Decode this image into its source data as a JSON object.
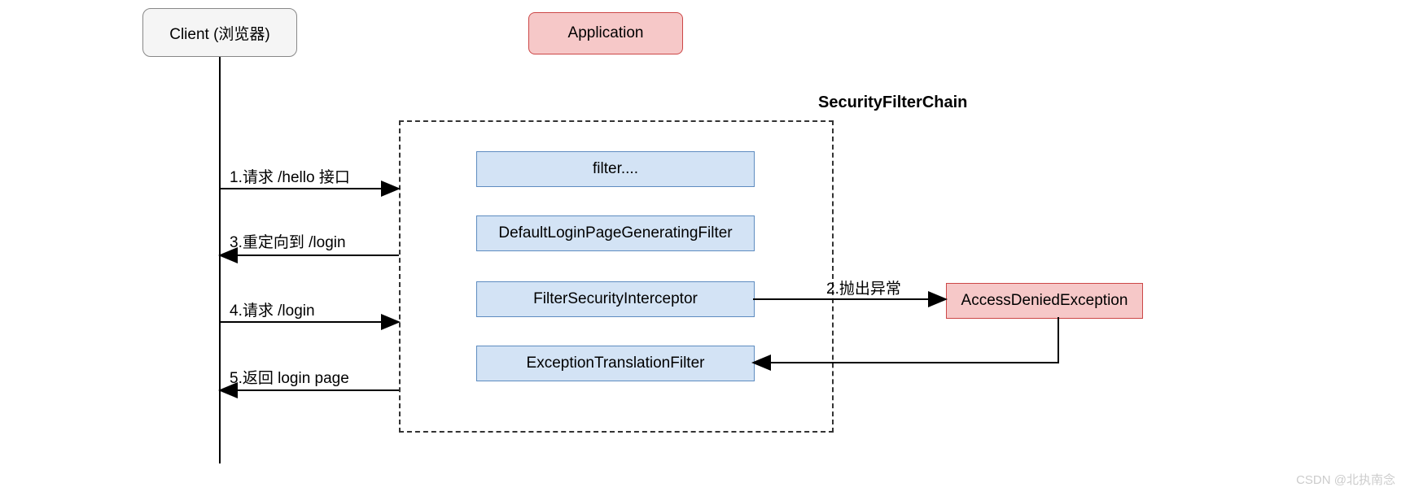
{
  "nodes": {
    "client": "Client (浏览器)",
    "application": "Application",
    "sfc_title": "SecurityFilterChain",
    "filters": {
      "f1": "filter....",
      "f2": "DefaultLoginPageGeneratingFilter",
      "f3": "FilterSecurityInterceptor",
      "f4": "ExceptionTranslationFilter"
    },
    "exception": "AccessDeniedException"
  },
  "edges": {
    "step1": "1.请求 /hello 接口",
    "step2": "2.抛出异常",
    "step3": "3.重定向到 /login",
    "step4": "4.请求 /login",
    "step5": "5.返回 login page"
  },
  "watermark": "CSDN @北执南念"
}
